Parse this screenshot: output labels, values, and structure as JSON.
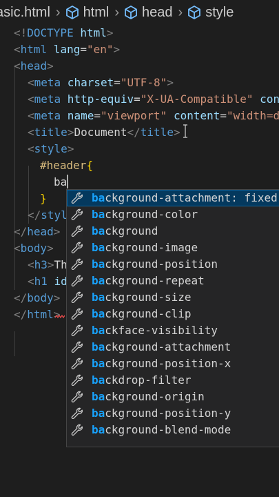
{
  "breadcrumb": [
    {
      "label": "asic.html",
      "icon": "none"
    },
    {
      "label": "html",
      "icon": "cube-icon"
    },
    {
      "label": "head",
      "icon": "cube-icon"
    },
    {
      "label": "style",
      "icon": "cube-icon"
    }
  ],
  "code": {
    "l1": {
      "a": "<!",
      "b": "DOCTYPE",
      "c": " html",
      "d": ">"
    },
    "l2": {
      "a": "<",
      "b": "html",
      "c": " lang",
      "d": "=",
      "e": "\"en\"",
      "f": ">"
    },
    "l3": {
      "a": "<",
      "b": "head",
      "c": ">"
    },
    "l4": {
      "a": "<",
      "b": "meta",
      "c": " charset",
      "d": "=",
      "e": "\"UTF-8\"",
      "f": ">"
    },
    "l5": {
      "a": "<",
      "b": "meta",
      "c": " http-equiv",
      "d": "=",
      "e": "\"X-UA-Compatible\"",
      "f": " con"
    },
    "l6": {
      "a": "<",
      "b": "meta",
      "c": " name",
      "d": "=",
      "e": "\"viewport\"",
      "f": " content",
      "g": "=",
      "h": "\"width=d"
    },
    "l7": {
      "a": "<",
      "b": "title",
      "c": ">",
      "d": "Document",
      "e": "</",
      "f": "title",
      "g": ">"
    },
    "l8": {
      "a": "<",
      "b": "style",
      "c": ">"
    },
    "l9": {
      "a": "#header",
      "b": "{"
    },
    "l10": {
      "a": "ba"
    },
    "l11": {
      "a": "}"
    },
    "l12": {
      "a": "</",
      "b": "styl"
    },
    "l13": {
      "a": "</",
      "b": "head",
      "c": ">"
    },
    "l14": {
      "a": "<",
      "b": "body",
      "c": ">"
    },
    "l15": {
      "a": "<",
      "b": "h3",
      "c": ">",
      "d": "Th"
    },
    "l16": {
      "a": "<",
      "b": "h1",
      "c": " id"
    },
    "l17": {
      "a": "</",
      "b": "body",
      "c": ">"
    },
    "l18": {
      "a": "</",
      "b": "html",
      "c": ">"
    }
  },
  "suggestions": [
    {
      "match": "ba",
      "rest": "ckground-attachment: fixed"
    },
    {
      "match": "ba",
      "rest": "ckground-color"
    },
    {
      "match": "ba",
      "rest": "ckground"
    },
    {
      "match": "ba",
      "rest": "ckground-image"
    },
    {
      "match": "ba",
      "rest": "ckground-position"
    },
    {
      "match": "ba",
      "rest": "ckground-repeat"
    },
    {
      "match": "ba",
      "rest": "ckground-size"
    },
    {
      "match": "ba",
      "rest": "ckground-clip"
    },
    {
      "match": "ba",
      "rest": "ckface-visibility"
    },
    {
      "match": "ba",
      "rest": "ckground-attachment"
    },
    {
      "match": "ba",
      "rest": "ckground-position-x"
    },
    {
      "match": "ba",
      "rest": "ckdrop-filter"
    },
    {
      "match": "ba",
      "rest": "ckground-origin"
    },
    {
      "match": "ba",
      "rest": "ckground-position-y"
    },
    {
      "match": "ba",
      "rest": "ckground-blend-mode"
    }
  ],
  "colors": {
    "background": "#1e1e1e",
    "tag": "#569cd6",
    "attribute": "#9cdcfe",
    "string": "#ce9178",
    "selector": "#d7ba7d",
    "match_highlight": "#18a3ff",
    "suggest_background": "#252526",
    "suggest_selected": "#04395e"
  }
}
